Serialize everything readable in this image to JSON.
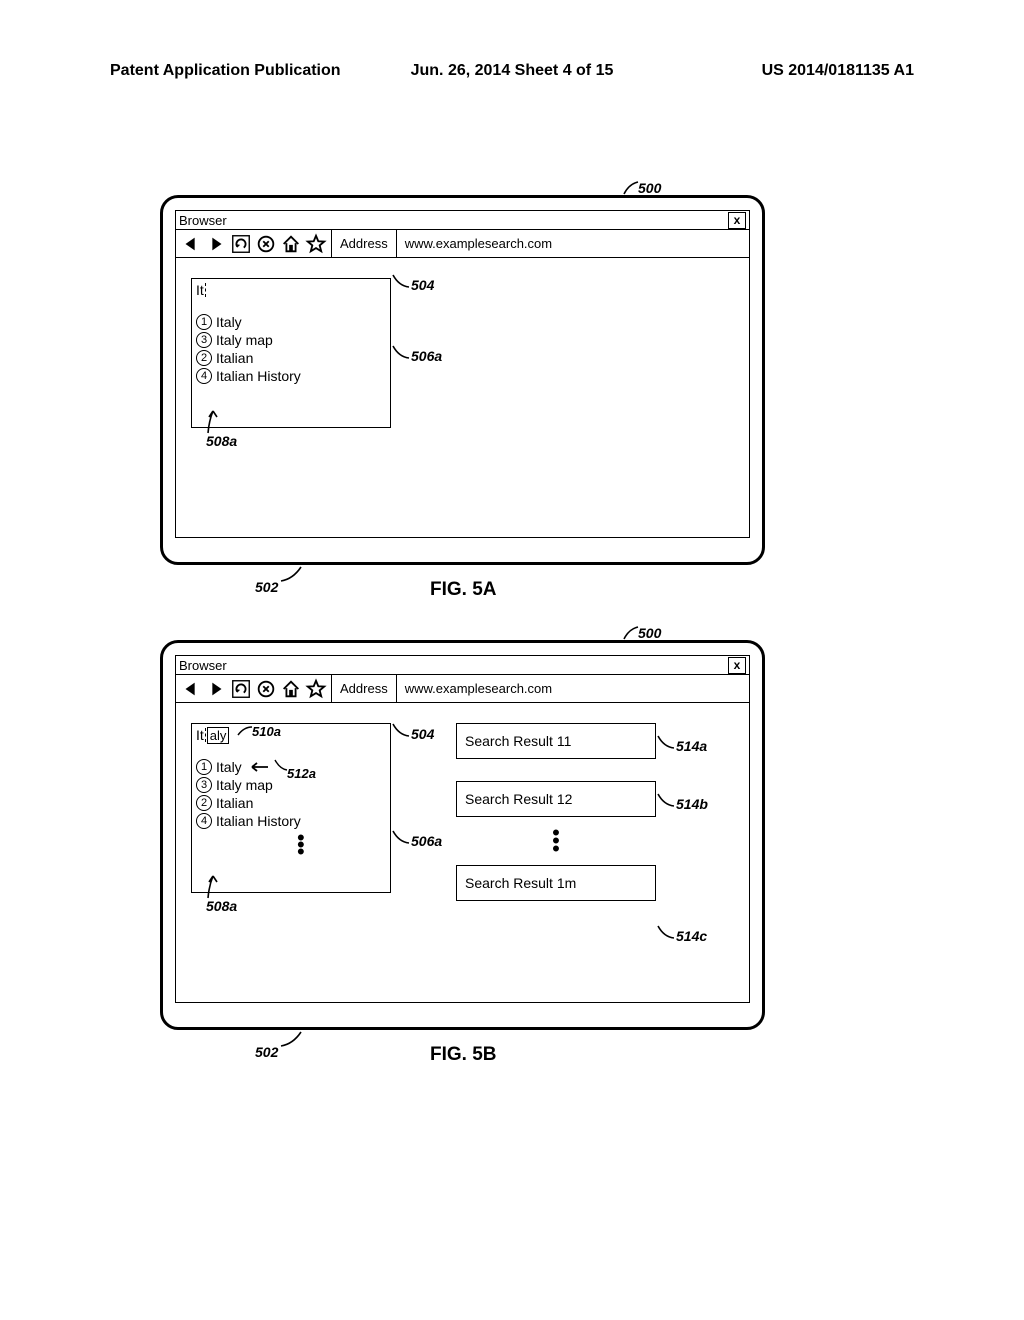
{
  "header": {
    "left": "Patent Application Publication",
    "center": "Jun. 26, 2014  Sheet 4 of 15",
    "right": "US 2014/0181135 A1"
  },
  "browser": {
    "title": "Browser",
    "address_label": "Address",
    "address_value": "www.examplesearch.com",
    "close": "x"
  },
  "figA": {
    "typed": "It",
    "suggestions": [
      {
        "num": "1",
        "text": "Italy"
      },
      {
        "num": "3",
        "text": "Italy map"
      },
      {
        "num": "2",
        "text": "Italian"
      },
      {
        "num": "4",
        "text": "Italian History"
      }
    ],
    "caption": "FIG. 5A"
  },
  "figB": {
    "typed": "It",
    "completion": "aly",
    "suggestions": [
      {
        "num": "1",
        "text": "Italy"
      },
      {
        "num": "3",
        "text": "Italy map"
      },
      {
        "num": "2",
        "text": "Italian"
      },
      {
        "num": "4",
        "text": "Italian History"
      }
    ],
    "results": {
      "r1": "Search Result 11",
      "r2": "Search Result 12",
      "rm": "Search Result 1m"
    },
    "caption": "FIG. 5B"
  },
  "refs": {
    "r500": "500",
    "r502": "502",
    "r504": "504",
    "r506a": "506a",
    "r508a": "508a",
    "r510a": "510a",
    "r512a": "512a",
    "r514a": "514a",
    "r514b": "514b",
    "r514c": "514c"
  }
}
